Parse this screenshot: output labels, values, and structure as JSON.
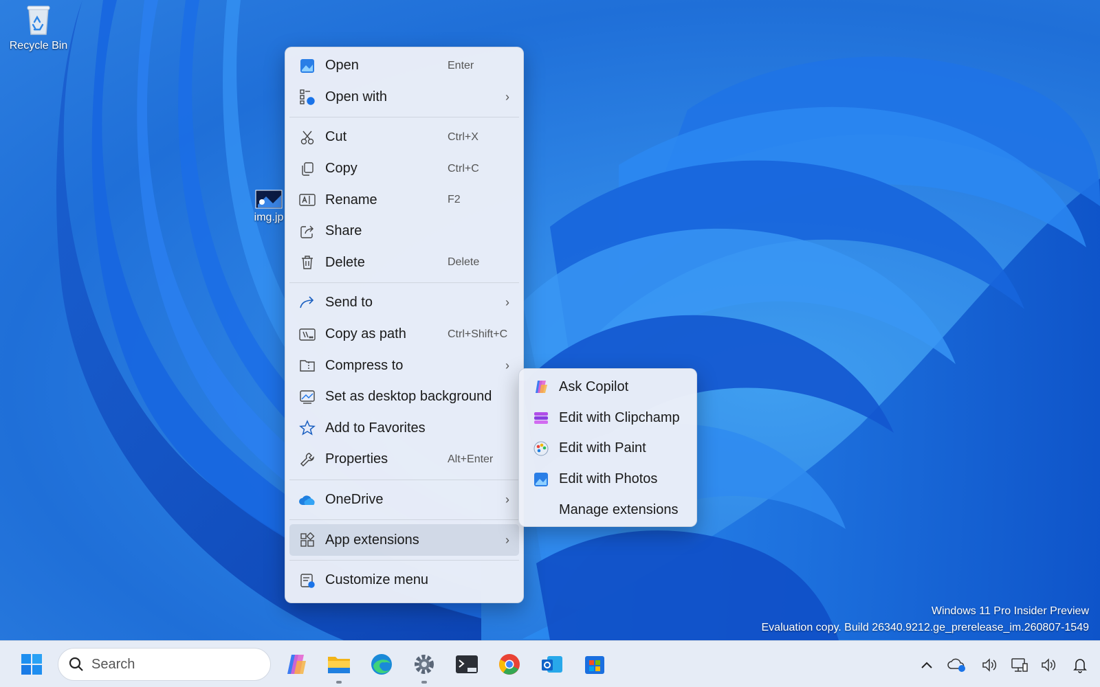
{
  "desktop": {
    "recycle_bin_label": "Recycle Bin",
    "file_label": "img.jp"
  },
  "watermark": {
    "line1": "Windows 11 Pro Insider Preview",
    "line2": "Evaluation copy. Build 26340.9212.ge_prerelease_im.260807-1549"
  },
  "context_menu": {
    "open": {
      "label": "Open",
      "shortcut": "Enter",
      "icon": "photos-icon"
    },
    "open_with": {
      "label": "Open with",
      "icon": "open-with-icon"
    },
    "cut": {
      "label": "Cut",
      "shortcut": "Ctrl+X",
      "icon": "scissors-icon"
    },
    "copy": {
      "label": "Copy",
      "shortcut": "Ctrl+C",
      "icon": "copy-icon"
    },
    "rename": {
      "label": "Rename",
      "shortcut": "F2",
      "icon": "rename-icon"
    },
    "share": {
      "label": "Share",
      "icon": "share-icon"
    },
    "delete": {
      "label": "Delete",
      "shortcut": "Delete",
      "icon": "trash-icon"
    },
    "send_to": {
      "label": "Send to",
      "icon": "send-to-icon"
    },
    "copy_as_path": {
      "label": "Copy as path",
      "shortcut": "Ctrl+Shift+C",
      "icon": "path-icon"
    },
    "compress_to": {
      "label": "Compress to",
      "icon": "zip-folder-icon"
    },
    "set_background": {
      "label": "Set as desktop background",
      "icon": "wallpaper-icon"
    },
    "add_favorites": {
      "label": "Add to Favorites",
      "icon": "star-icon"
    },
    "properties": {
      "label": "Properties",
      "shortcut": "Alt+Enter",
      "icon": "wrench-icon"
    },
    "onedrive": {
      "label": "OneDrive",
      "icon": "onedrive-cloud-icon"
    },
    "app_extensions": {
      "label": "App extensions",
      "icon": "app-extensions-icon"
    },
    "customize": {
      "label": "Customize menu",
      "icon": "customize-icon"
    }
  },
  "submenu": {
    "ask_copilot": "Ask Copilot",
    "clipchamp": "Edit with Clipchamp",
    "paint": "Edit with Paint",
    "photos": "Edit with Photos",
    "manage": "Manage extensions"
  },
  "taskbar": {
    "search_placeholder": "Search",
    "apps": [
      "start-icon",
      "copilot-icon",
      "file-explorer-icon",
      "edge-icon",
      "settings-icon",
      "terminal-preview-icon",
      "chrome-icon",
      "outlook-icon",
      "store-icon"
    ],
    "tray": [
      "chevron-up-icon",
      "onedrive-status-icon",
      "volume-icon",
      "network-icon",
      "speaker-icon",
      "notification-icon"
    ]
  }
}
